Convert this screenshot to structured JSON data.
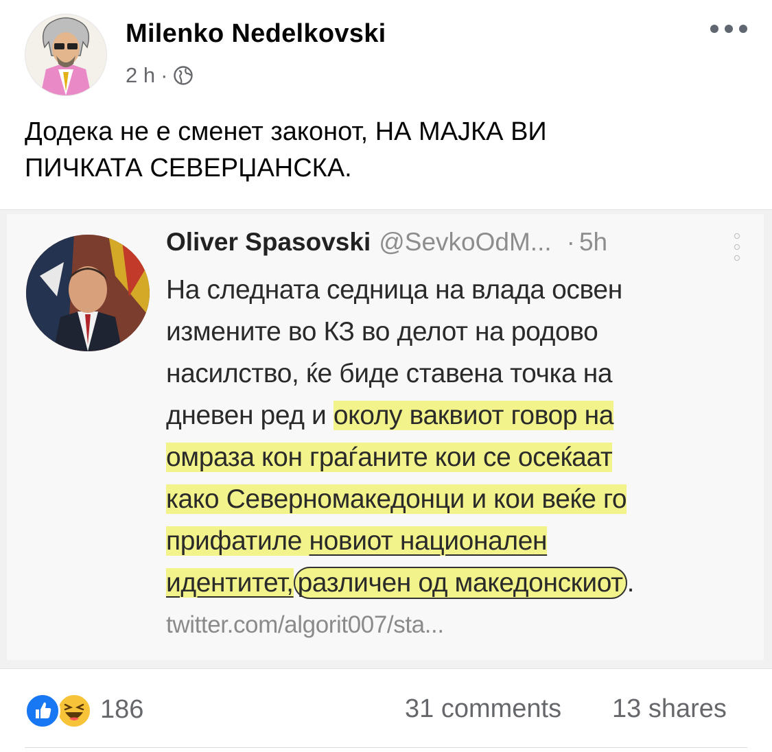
{
  "post": {
    "author": "Milenko Nedelkovski",
    "time": "2 h",
    "separator": "·",
    "audience_icon": "globe-icon",
    "text_lines": [
      "Додека не е сменет законот, НА МАЈКА ВИ",
      "ПИЧКАТА СЕВЕРЏАНСКА."
    ]
  },
  "tweet": {
    "name": "Oliver Spasovski",
    "handle": "@SevkoOdM...",
    "dot": "·",
    "time": "5h",
    "body": {
      "l1": "На следната седница на влада освен",
      "l2": "измените во КЗ во делот на родово",
      "l3": "насилство, ќе биде ставена точка на",
      "l4a": "дневен ред и ",
      "l4b": "околу ваквиот говор на",
      "l5": "омраза кон граѓаните кои се осеќаат",
      "l6": "како Северномакедонци и кои веќе го",
      "l7a": "прифатиле ",
      "l7b": "новиот национален",
      "l8a": "идентитет,",
      "l8b": "различен од македонскиот",
      "l8c": "."
    },
    "link": "twitter.com/algorit007/sta..."
  },
  "footer": {
    "reaction_icons": [
      "like-icon",
      "haha-icon"
    ],
    "reaction_count": "186",
    "comments": "31 comments",
    "shares": "13 shares"
  },
  "colors": {
    "highlight": "#f3f38c",
    "like": "#1877f2",
    "haha": "#f7c339",
    "secondary_text": "#65676b"
  }
}
